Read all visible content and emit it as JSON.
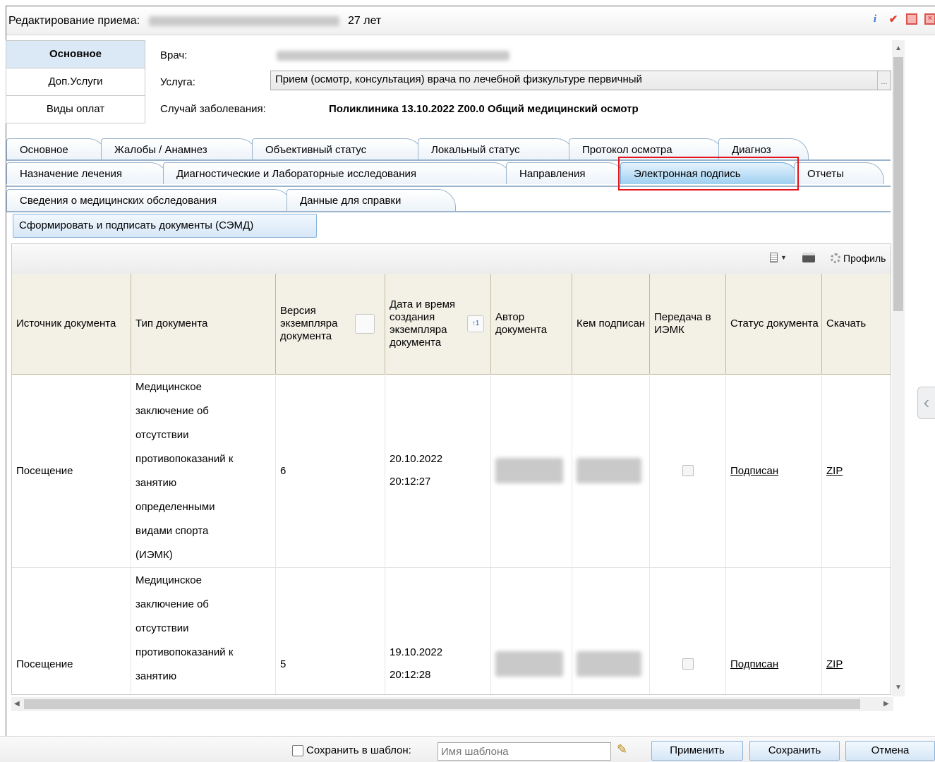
{
  "title": {
    "label": "Редактирование приема:",
    "age": "27 лет"
  },
  "subnav": [
    "Основное",
    "Доп.Услуги",
    "Виды оплат"
  ],
  "fields": {
    "doctor_label": "Врач:",
    "service_label": "Услуга:",
    "service_value": "Прием (осмотр, консультация) врача по лечебной физкультуре первичный",
    "case_label": "Случай заболевания:",
    "case_value": "Поликлиника 13.10.2022 Z00.0 Общий медицинский осмотр"
  },
  "tabs_row1": [
    "Основное",
    "Жалобы / Анамнез",
    "Объективный статус",
    "Локальный статус",
    "Протокол осмотра",
    "Диагноз"
  ],
  "tabs_row2": [
    "Назначение лечения",
    "Диагностические и Лабораторные исследования",
    "Направления",
    "Электронная подпись",
    "Отчеты"
  ],
  "tabs_row3": [
    "Сведения о медицинских обследования",
    "Данные для справки"
  ],
  "action_button": "Сформировать и подписать документы (СЭМД)",
  "toolbar": {
    "profile": "Профиль"
  },
  "columns": [
    "Источник документа",
    "Тип документа",
    "Версия экземпляра документа",
    "Дата и время создания экземпляра документа",
    "Автор документа",
    "Кем подписан",
    "Передача в ИЭМК",
    "Статус документа",
    "Скачать"
  ],
  "rows": [
    {
      "source": "Посещение",
      "type_lines": [
        "Медицинское",
        "заключение об",
        "отсутствии",
        "противопоказаний к",
        "занятию",
        "определенными",
        "видами спорта",
        "(ИЭМК)"
      ],
      "version": "6",
      "date": "20.10.2022",
      "time": "20:12:27",
      "status": "Подписан",
      "download": "ZIP"
    },
    {
      "source": "Посещение",
      "type_lines": [
        "Медицинское",
        "заключение об",
        "отсутствии",
        "противопоказаний к",
        "занятию"
      ],
      "version": "5",
      "date": "19.10.2022",
      "time": "20:12:28",
      "status": "Подписан",
      "download": "ZIP"
    }
  ],
  "footer": {
    "save_template": "Сохранить в шаблон:",
    "template_placeholder": "Имя шаблона",
    "apply": "Применить",
    "save": "Сохранить",
    "cancel": "Отмена"
  },
  "colors": {
    "accent": "#9fd0f1",
    "highlight": "#e3141b",
    "header_bg": "#f3f0e6"
  }
}
